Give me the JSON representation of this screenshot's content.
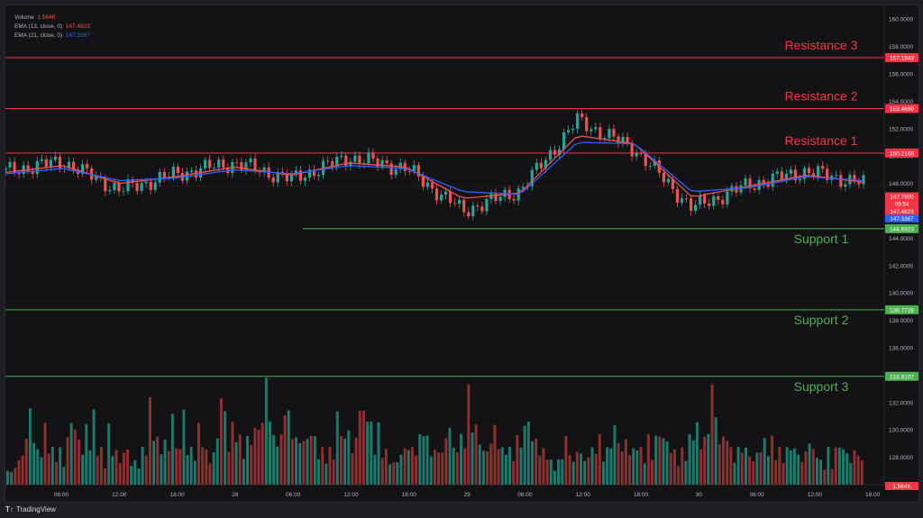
{
  "legend": {
    "volume_label": "Volume",
    "volume_value": "1.564K",
    "ema1_label": "EMA (13, close, 0)",
    "ema1_value": "147.4823",
    "ema2_label": "EMA (21, close, 0)",
    "ema2_value": "147.3367"
  },
  "brand": {
    "logo": "T↑",
    "name": "TradingView"
  },
  "chart_data": {
    "type": "line",
    "title": "",
    "xlabel": "",
    "ylabel": "",
    "ylim": [
      126,
      161
    ],
    "y_ticks": [
      "160.0000",
      "158.0000",
      "156.0000",
      "154.0000",
      "152.0000",
      "150.0000",
      "148.0000",
      "146.0000",
      "144.0000",
      "142.0000",
      "140.0000",
      "138.0000",
      "136.0000",
      "134.0000",
      "132.0000",
      "130.0000",
      "128.0000"
    ],
    "x_ticks": [
      "06:00",
      "12:00",
      "18:00",
      "28",
      "06:00",
      "12:00",
      "18:00",
      "29",
      "06:00",
      "12:00",
      "18:00",
      "30",
      "06:00",
      "12:00",
      "18:00"
    ],
    "x": [
      0,
      6,
      12,
      18,
      24,
      30,
      36,
      42,
      48,
      54,
      60,
      66,
      72,
      78,
      84,
      90
    ],
    "series": [
      {
        "name": "price",
        "color": "#26a69a",
        "values": [
          148.9,
          149.6,
          147.5,
          148.7,
          149.5,
          148.3,
          149.9,
          149.1,
          146.0,
          147.5,
          152.6,
          150.5,
          146.2,
          147.9,
          148.9,
          148.0
        ]
      },
      {
        "name": "EMA (13, close, 0)",
        "color": "#ef5350",
        "values": [
          148.8,
          149.3,
          148.0,
          148.5,
          149.2,
          148.6,
          149.5,
          149.2,
          146.9,
          147.3,
          151.5,
          150.9,
          147.0,
          147.8,
          148.6,
          148.1
        ]
      },
      {
        "name": "EMA (21, close, 0)",
        "color": "#2962ff",
        "values": [
          148.7,
          149.1,
          148.2,
          148.4,
          149.0,
          148.7,
          149.3,
          149.1,
          147.4,
          147.2,
          151.0,
          150.9,
          147.4,
          147.7,
          148.5,
          148.2
        ]
      }
    ],
    "levels": [
      {
        "name": "Resistance 3",
        "label": "Resistance 3",
        "value": 157.1843,
        "tag": "157.1843",
        "color": "#f23645"
      },
      {
        "name": "Resistance 2",
        "label": "Resistance 2",
        "value": 153.4699,
        "tag": "153.4699",
        "color": "#f23645"
      },
      {
        "name": "Resistance 1",
        "label": "Resistance 1",
        "value": 150.2168,
        "tag": "150.2168",
        "color": "#f23645"
      },
      {
        "name": "Support 1",
        "label": "Support 1",
        "value": 144.6923,
        "tag": "144.6923",
        "color": "#4caf50"
      },
      {
        "name": "Support 2",
        "label": "Support 2",
        "value": 138.7728,
        "tag": "138.7728",
        "color": "#4caf50"
      },
      {
        "name": "Support 3",
        "label": "Support 3",
        "value": 133.9107,
        "tag": "133.9107",
        "color": "#4caf50"
      }
    ],
    "price_tags": [
      {
        "name": "last-price",
        "value": 147.79,
        "tag": "147.7900",
        "color": "#f23645"
      },
      {
        "name": "countdown",
        "value": 147.55,
        "tag": "09:54",
        "color": "#f23645"
      },
      {
        "name": "ema13",
        "value": 147.4823,
        "tag": "147.4823",
        "color": "#f23645"
      },
      {
        "name": "ema21",
        "value": 147.3367,
        "tag": "147.3367",
        "color": "#2962ff"
      }
    ],
    "volume": {
      "tag": "1.564K",
      "tag_color": "#f23645",
      "profile": [
        2,
        1,
        2,
        2,
        3,
        4,
        7,
        4,
        3,
        3,
        5,
        4,
        3,
        3,
        3,
        2,
        4,
        6,
        5,
        4,
        3,
        5,
        4,
        6,
        4,
        3,
        2,
        5,
        3,
        3,
        2,
        3,
        3,
        2,
        2,
        2,
        3,
        4,
        7,
        5,
        4,
        3,
        4,
        3,
        7,
        3,
        4,
        6,
        4,
        3,
        3,
        5,
        4,
        3,
        2,
        3,
        4,
        9,
        6,
        4,
        5,
        6,
        4,
        3,
        4,
        4,
        5,
        5,
        6,
        9,
        7,
        4,
        5,
        4,
        9,
        6,
        5,
        4,
        4,
        4,
        4,
        5,
        4,
        3,
        3,
        3,
        3,
        3,
        6,
        5,
        4,
        5,
        3,
        4,
        8,
        6,
        8,
        5,
        4,
        5,
        3,
        3,
        2,
        2,
        2,
        3,
        3,
        4,
        3,
        4,
        4,
        6,
        4,
        3,
        3,
        3,
        3,
        4,
        6,
        3,
        4,
        4,
        5,
        8,
        6,
        5,
        4,
        3,
        3,
        4,
        5,
        4,
        3,
        4,
        3,
        3,
        4,
        4,
        5,
        6,
        4,
        4,
        3,
        3,
        3,
        2,
        2,
        2,
        3,
        4,
        3,
        2,
        3,
        3,
        2,
        3,
        3,
        4,
        4,
        3,
        3,
        4,
        5,
        4,
        3,
        4,
        3,
        3,
        4,
        3,
        3,
        4,
        3,
        4,
        5,
        4,
        4,
        3,
        3,
        2,
        3,
        3,
        4,
        6,
        5,
        4,
        4,
        5,
        9,
        6,
        4,
        4,
        5,
        3,
        3,
        3,
        4,
        3,
        3,
        2,
        3,
        3,
        4,
        3,
        4,
        3,
        3,
        3,
        3,
        4,
        3,
        3,
        2,
        3,
        4,
        3,
        3,
        2,
        2,
        3,
        2,
        3,
        4,
        3,
        3,
        2,
        3,
        3,
        2
      ]
    },
    "grid": false,
    "legend": "top-left"
  }
}
